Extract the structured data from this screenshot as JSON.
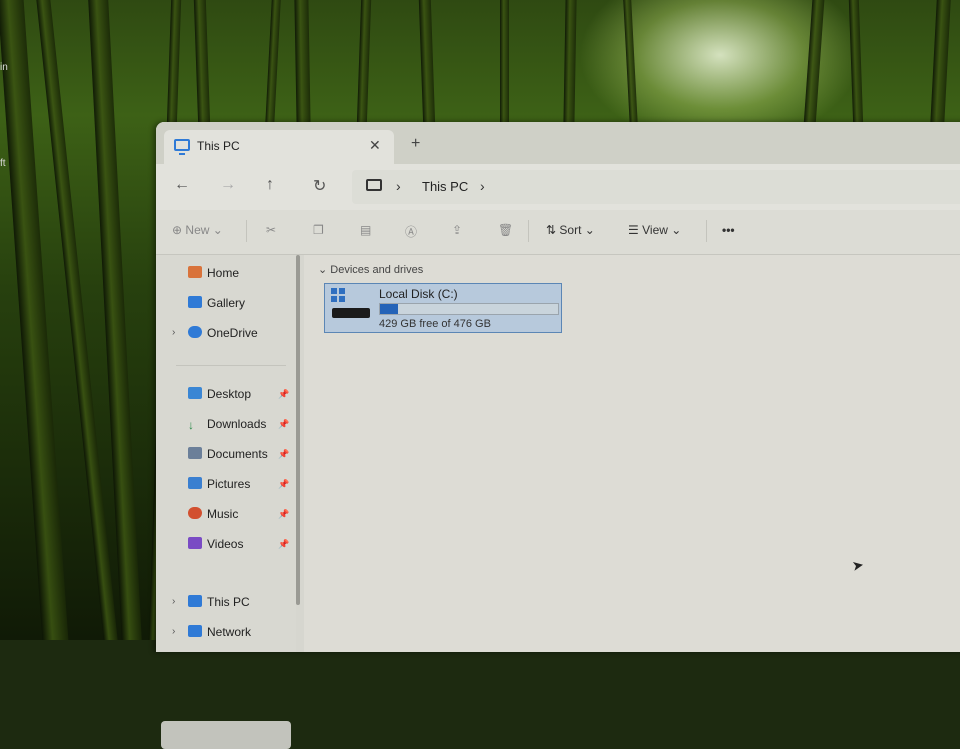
{
  "desktop": {
    "side_text_1": "in",
    "side_text_2": "ft"
  },
  "tab": {
    "title": "This PC",
    "close": "✕",
    "new_tab": "+"
  },
  "nav": {
    "back": "←",
    "forward": "→",
    "up": "↑",
    "refresh": "↻"
  },
  "address": {
    "separator": "›",
    "location": "This PC"
  },
  "toolbar": {
    "new_label": "New",
    "sort_label": "Sort",
    "view_label": "View",
    "more": "•••"
  },
  "sidebar": {
    "items": [
      {
        "label": "Home",
        "icon": "home-icon",
        "color": "#d9733b"
      },
      {
        "label": "Gallery",
        "icon": "gallery-icon",
        "color": "#2f7ad6"
      },
      {
        "label": "OneDrive",
        "icon": "onedrive-icon",
        "color": "#2f7ad6"
      },
      {
        "label": "Desktop",
        "icon": "desktop-icon",
        "color": "#3a86d4"
      },
      {
        "label": "Downloads",
        "icon": "download-icon",
        "color": "#2b8a4a"
      },
      {
        "label": "Documents",
        "icon": "documents-icon",
        "color": "#6b7f99"
      },
      {
        "label": "Pictures",
        "icon": "pictures-icon",
        "color": "#3a7fd0"
      },
      {
        "label": "Music",
        "icon": "music-icon",
        "color": "#d2502f"
      },
      {
        "label": "Videos",
        "icon": "videos-icon",
        "color": "#7a4bc4"
      },
      {
        "label": "This PC",
        "icon": "this-pc-icon",
        "color": "#2f7ad6"
      },
      {
        "label": "Network",
        "icon": "network-icon",
        "color": "#2f7ad6"
      }
    ]
  },
  "main": {
    "section_title": "Devices and drives",
    "drive": {
      "name": "Local Disk (C:)",
      "free_text": "429 GB free of 476 GB",
      "used_fraction": 0.099
    }
  }
}
